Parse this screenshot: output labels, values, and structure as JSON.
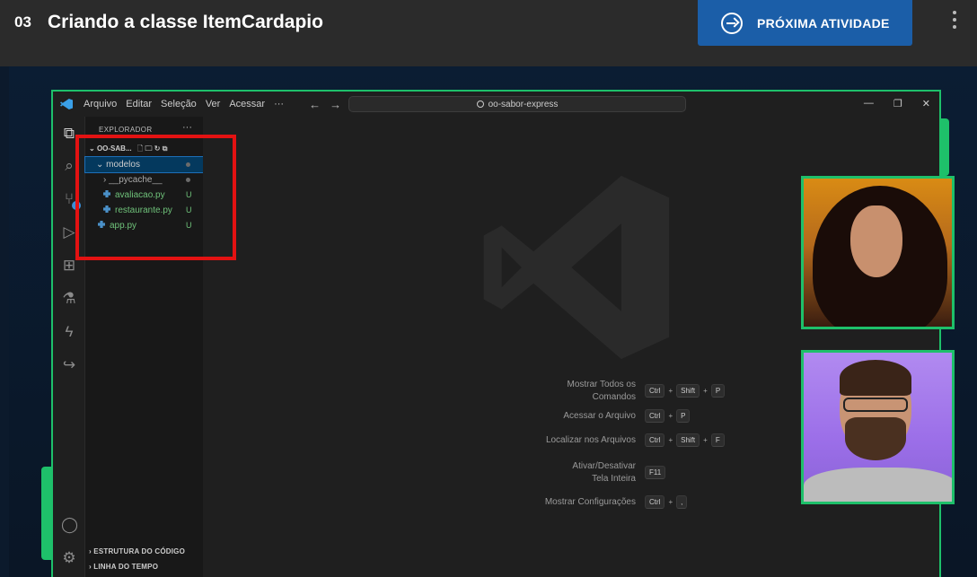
{
  "course": {
    "lesson_number": "03",
    "lesson_title": "Criando a classe ItemCardapio",
    "next_button": "PRÓXIMA ATIVIDADE"
  },
  "vscode": {
    "menu": [
      "Arquivo",
      "Editar",
      "Seleção",
      "Ver",
      "Acessar",
      "···"
    ],
    "search_text": "oo-sabor-express",
    "explorer_title": "EXPLORADOR",
    "explorer_more": "···",
    "project_name": "OO-SAB...",
    "tree": {
      "folder_modelos": "modelos",
      "pycache": "__pycache__",
      "avaliacao": "avaliacao.py",
      "avaliacao_status": "U",
      "restaurante": "restaurante.py",
      "restaurante_status": "U",
      "app": "app.py",
      "app_status": "U"
    },
    "footer_outline": "ESTRUTURA DO CÓDIGO",
    "footer_timeline": "LINHA DO TEMPO",
    "shortcuts": [
      {
        "label": "Mostrar Todos os Comandos",
        "keys": [
          "Ctrl",
          "+",
          "Shift",
          "+",
          "P"
        ]
      },
      {
        "label": "Acessar o Arquivo",
        "keys": [
          "Ctrl",
          "+",
          "P"
        ]
      },
      {
        "label": "Localizar nos Arquivos",
        "keys": [
          "Ctrl",
          "+",
          "Shift",
          "+",
          "F"
        ]
      },
      {
        "label": "Ativar/Desativar Tela Inteira",
        "keys": [
          "F11"
        ]
      },
      {
        "label": "Mostrar Configurações",
        "keys": [
          "Ctrl",
          "+",
          ","
        ]
      }
    ]
  },
  "colors": {
    "accent_green": "#1ec06a",
    "highlight_red": "#e31212",
    "button_blue": "#1b5ea8"
  }
}
